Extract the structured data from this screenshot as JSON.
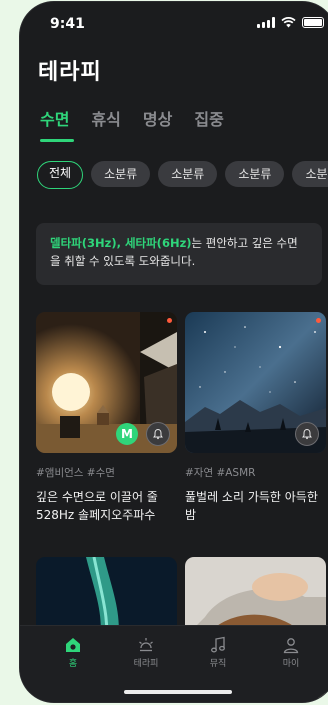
{
  "status": {
    "time": "9:41"
  },
  "page": {
    "title": "테라피"
  },
  "tabs": [
    {
      "label": "수면",
      "active": true
    },
    {
      "label": "휴식"
    },
    {
      "label": "명상"
    },
    {
      "label": "집중"
    }
  ],
  "chips": [
    {
      "label": "전체",
      "active": true
    },
    {
      "label": "소분류"
    },
    {
      "label": "소분류"
    },
    {
      "label": "소분류"
    },
    {
      "label": "소분류"
    }
  ],
  "info": {
    "highlight": "델타파(3Hz), 세타파(6Hz)",
    "text": "는 편안하고 깊은 수면을 취할 수 있도록 도와줍니다."
  },
  "cards": [
    {
      "tags": "#앰비언스 #수면",
      "title": "깊은 수면으로 이끌어 줄 528Hz 솔페지오주파수",
      "badge": "M"
    },
    {
      "tags": "#자연 #ASMR",
      "title": "풀벌레 소리 가득한 아득한 밤"
    }
  ],
  "nav": [
    {
      "label": "홈",
      "icon": "home-icon",
      "active": true
    },
    {
      "label": "테라피",
      "icon": "sun-icon"
    },
    {
      "label": "뮤직",
      "icon": "music-note-icon"
    },
    {
      "label": "마이",
      "icon": "profile-icon"
    }
  ],
  "colors": {
    "accent": "#2fd57a",
    "background": "#1b1c1e",
    "outer": "#eaf8e8"
  }
}
